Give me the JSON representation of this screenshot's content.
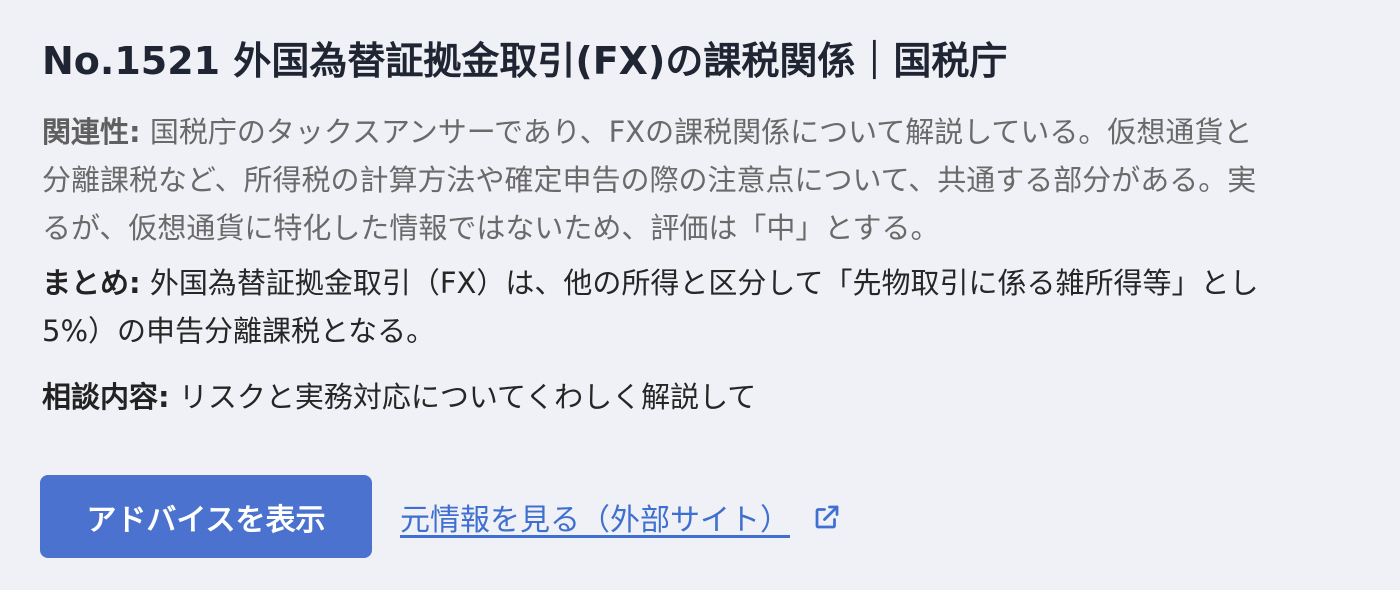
{
  "result": {
    "title": "No.1521 外国為替証拠金取引(FX)の課税関係｜国税庁",
    "relevance_label": "関連性:",
    "relevance_lines": [
      " 国税庁のタックスアンサーであり、FXの課税関係について解説している。仮想通貨と",
      "分離課税など、所得税の計算方法や確定申告の際の注意点について、共通する部分がある。実",
      "るが、仮想通貨に特化した情報ではないため、評価は「中」とする。"
    ],
    "summary_label": "まとめ:",
    "summary_lines": [
      " 外国為替証拠金取引（FX）は、他の所得と区分して「先物取引に係る雑所得等」とし",
      "5%）の申告分離課税となる。"
    ],
    "consult_label": "相談内容:",
    "consult_text": " リスクと実務対応についてくわしく解説して"
  },
  "actions": {
    "advice_button_label": "アドバイスを表示",
    "source_link_label": "元情報を見る（外部サイト）",
    "source_link_icon": "external-link-icon"
  },
  "colors": {
    "button": "#4a72ce",
    "link": "#3f6fd0",
    "background": "#f0f1f6"
  }
}
